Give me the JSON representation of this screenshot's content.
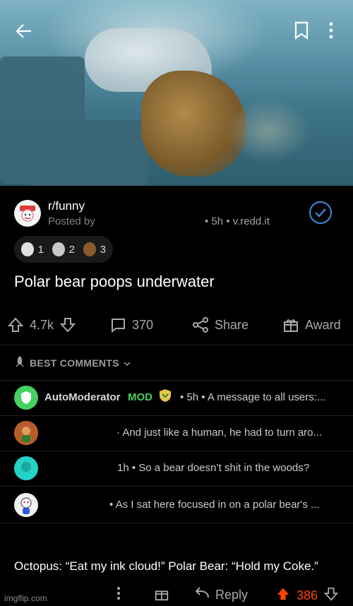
{
  "media": {
    "description_icon_back": "arrow-left-icon",
    "bookmark_icon": "bookmark-icon",
    "more_icon": "kebab-icon"
  },
  "post": {
    "subreddit": "r/funny",
    "posted_by": "Posted by",
    "meta": "• 5h • v.redd.it",
    "title": "Polar bear poops underwater",
    "awards": [
      {
        "icon": "awesome-answer-icon",
        "count": "1"
      },
      {
        "icon": "silver-icon",
        "count": "2"
      },
      {
        "icon": "bear-icon",
        "count": "3"
      }
    ],
    "actions": {
      "votes": "4.7k",
      "comments": "370",
      "share": "Share",
      "award": "Award"
    }
  },
  "comments_header": "BEST COMMENTS",
  "comments": [
    {
      "author": "AutoModerator",
      "badge": "MOD",
      "text": "• 5h • A message to all users:..."
    },
    {
      "text": "· And just like a human, he had to turn aro..."
    },
    {
      "text": "1h • So a bear doesn’t shit in the woods?"
    },
    {
      "text": "• As I sat here focused in on a polar bear's ..."
    }
  ],
  "bottom_comment": "Octopus: “Eat my ink cloud!” Polar Bear: “Hold my Coke.”",
  "bottom_bar": {
    "reply": "Reply",
    "votes": "386"
  },
  "watermark": "imgflip.com",
  "colors": {
    "accent_blue": "#3d8be0",
    "upvote_orange": "#ff4500",
    "mod_green": "#46d160"
  }
}
